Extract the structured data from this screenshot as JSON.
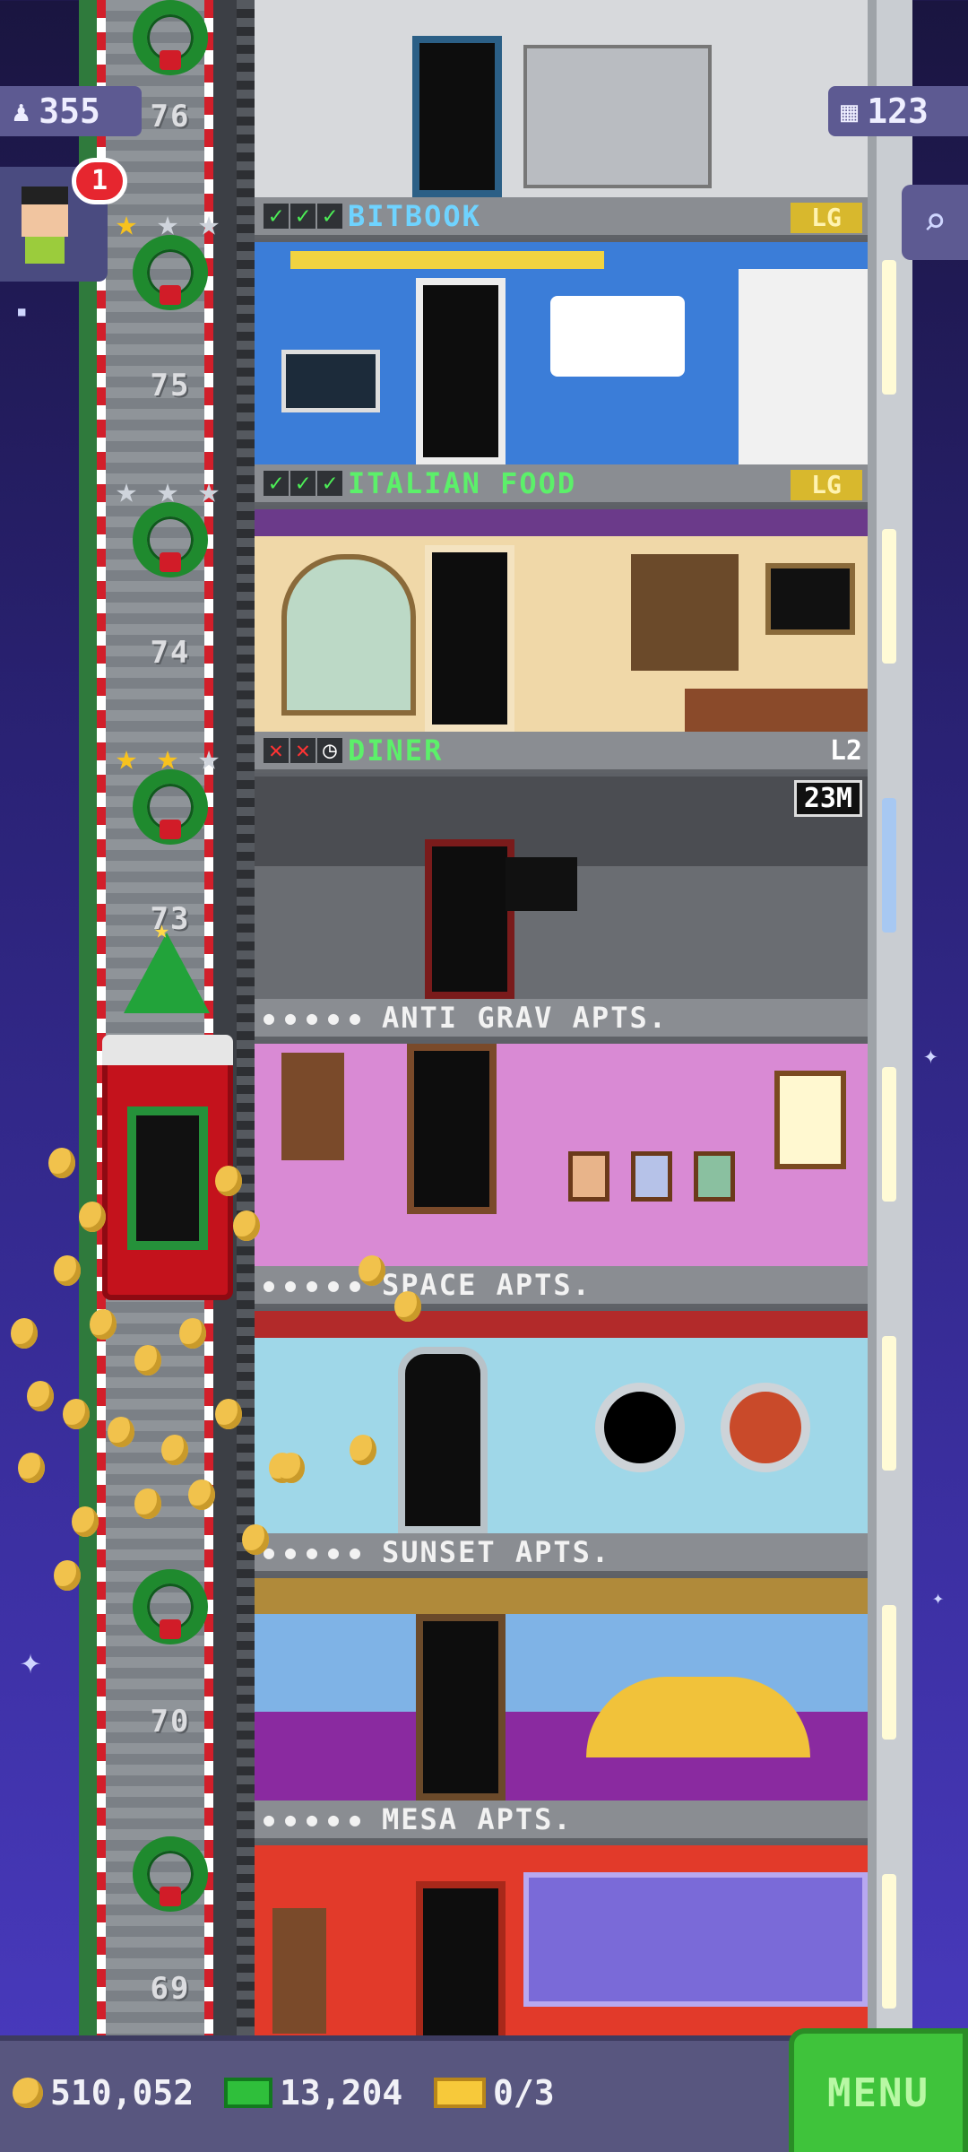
{
  "top_overlay": {
    "population": "355",
    "floors": "123",
    "notification_count": "1"
  },
  "floor_numbers": [
    "76",
    "75",
    "74",
    "73",
    "70",
    "69"
  ],
  "floors": [
    {
      "name": "BITBOOK",
      "level": "LG",
      "color": "blue",
      "status": [
        "check",
        "check",
        "check"
      ]
    },
    {
      "name": "ITALIAN FOOD",
      "level": "LG",
      "color": "green",
      "status": [
        "check",
        "check",
        "check"
      ]
    },
    {
      "name": "DINER",
      "level": "L2",
      "timer": "23M",
      "color": "green",
      "status": [
        "x",
        "x",
        "clock"
      ]
    },
    {
      "name": "ANTI GRAV APTS.",
      "color": "white"
    },
    {
      "name": "SPACE APTS.",
      "color": "white"
    },
    {
      "name": "SUNSET APTS.",
      "color": "white"
    },
    {
      "name": "MESA APTS.",
      "color": "white"
    }
  ],
  "bottom_bar": {
    "coins": "510,052",
    "bux": "13,204",
    "tickets": "0/3",
    "menu_label": "MENU"
  },
  "colors": {
    "accent_green": "#3fc33b",
    "label_blue": "#6fd3ff",
    "label_green": "#5cf06a"
  },
  "icons": [
    "person-icon",
    "floors-icon",
    "zoom-icon",
    "coin-icon",
    "bux-icon",
    "ticket-icon",
    "star-icon",
    "wreath-icon"
  ]
}
